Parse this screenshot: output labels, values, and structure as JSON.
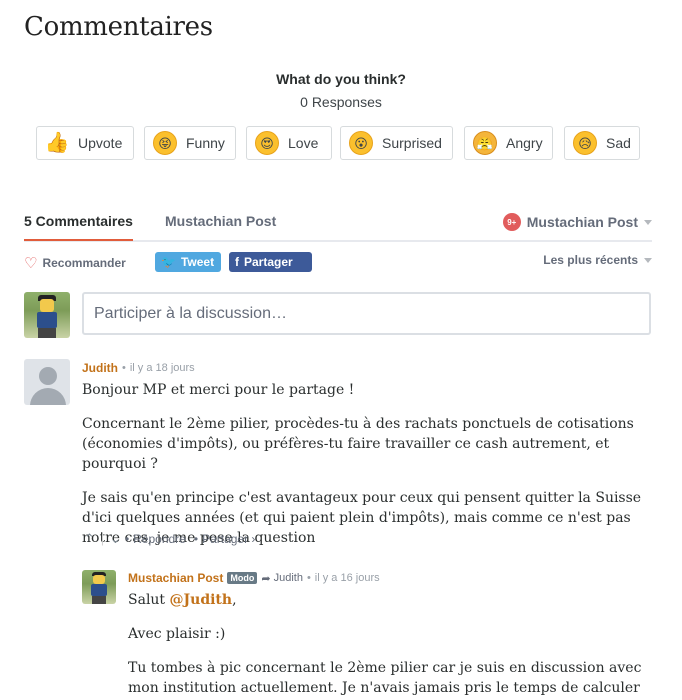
{
  "page": {
    "title": "Commentaires"
  },
  "reactions": {
    "title": "What do you think?",
    "count_text": "0 Responses",
    "items": [
      {
        "label": "Upvote",
        "icon": "thumbs-up-icon",
        "glyph": "👍"
      },
      {
        "label": "Funny",
        "icon": "laughing-face-icon",
        "glyph": "😝"
      },
      {
        "label": "Love",
        "icon": "heart-eyes-icon",
        "glyph": "😍"
      },
      {
        "label": "Surprised",
        "icon": "surprised-face-icon",
        "glyph": "😮"
      },
      {
        "label": "Angry",
        "icon": "angry-face-icon",
        "glyph": "😤"
      },
      {
        "label": "Sad",
        "icon": "sad-face-icon",
        "glyph": "😥"
      }
    ]
  },
  "tabs": {
    "comments": "5 Commentaires",
    "site": "Mustachian Post",
    "notif_count": "9+",
    "login": "Mustachian Post"
  },
  "actions": {
    "recommend": "Recommander",
    "tweet": "Tweet",
    "share": "Partager",
    "sort": "Les plus récents"
  },
  "compose": {
    "placeholder": "Participer à la discussion…"
  },
  "comments": [
    {
      "author": "Judith",
      "time": "il y a 18 jours",
      "paragraphs": [
        "Bonjour MP et merci pour le partage !",
        "Concernant le 2ème pilier, procèdes-tu à des rachats ponctuels de cotisations (économies d'impôts), ou préfères-tu faire travailler ce cash autrement, et pourquoi ?",
        "Je sais qu'en principe c'est avantageux pour ceux qui pensent quitter la Suisse d'ici quelques années (et qui paient plein d'impôts), mais comme ce n'est pas notre cas, je me pose la question"
      ],
      "reply_label": "Répondre",
      "share_label": "Partager ›"
    }
  ],
  "reply": {
    "author": "Mustachian Post",
    "badge": "Modo",
    "reply_to": "Judith",
    "time": "il y a 16 jours",
    "greeting": "Salut ",
    "mention": "@Judith",
    "greeting_end": ",",
    "paragraphs": [
      "Avec plaisir :)",
      "Tu tombes à pic concernant le 2ème pilier car je suis en discussion avec mon institution actuellement. Je n'avais jamais pris le temps de calculer car je n'ai que"
    ]
  },
  "colors": {
    "accent": "#e15c3b",
    "author": "#c2721a",
    "twitter": "#50a8e0",
    "facebook": "#3d5a99"
  }
}
